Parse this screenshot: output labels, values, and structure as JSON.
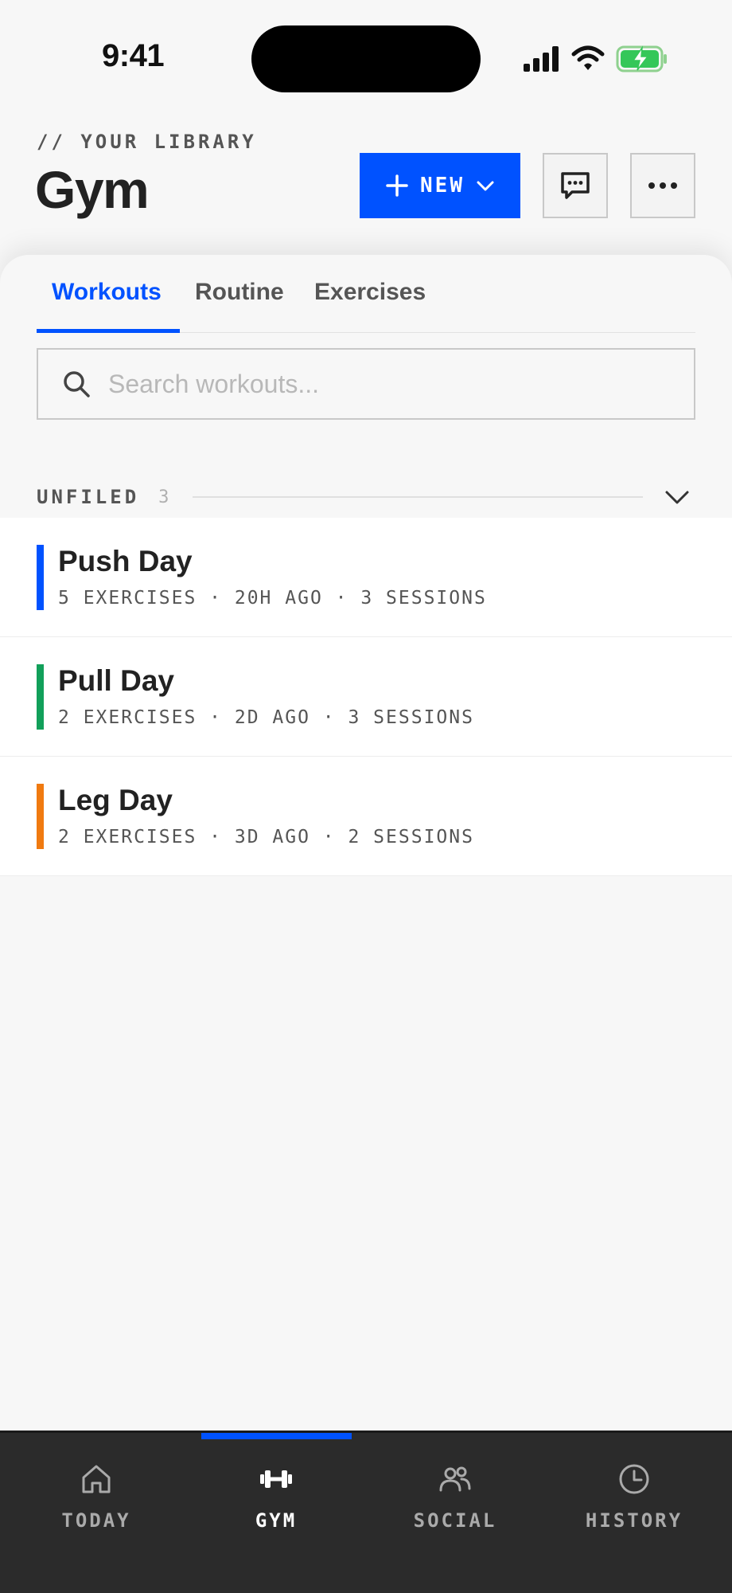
{
  "status_bar": {
    "time": "9:41"
  },
  "header": {
    "eyebrow": "// YOUR LIBRARY",
    "title": "Gym",
    "new_button_label": "NEW"
  },
  "tabs": [
    {
      "label": "Workouts",
      "active": true
    },
    {
      "label": "Routine",
      "active": false
    },
    {
      "label": "Exercises",
      "active": false
    }
  ],
  "search": {
    "placeholder": "Search workouts...",
    "value": ""
  },
  "section": {
    "label": "UNFILED",
    "count": "3"
  },
  "workouts": [
    {
      "name": "Push Day",
      "meta": "5 EXERCISES · 20H AGO · 3 SESSIONS",
      "color": "#0052ff"
    },
    {
      "name": "Pull Day",
      "meta": "2 EXERCISES · 2D AGO · 3 SESSIONS",
      "color": "#12a05a"
    },
    {
      "name": "Leg Day",
      "meta": "2 EXERCISES · 3D AGO · 2 SESSIONS",
      "color": "#f07a10"
    }
  ],
  "nav": [
    {
      "label": "TODAY",
      "icon": "home-icon",
      "active": false
    },
    {
      "label": "GYM",
      "icon": "dumbbell-icon",
      "active": true
    },
    {
      "label": "SOCIAL",
      "icon": "people-icon",
      "active": false
    },
    {
      "label": "HISTORY",
      "icon": "clock-icon",
      "active": false
    }
  ],
  "colors": {
    "accent": "#0052ff",
    "nav_bg": "#2b2b2b",
    "background": "#f7f7f7"
  }
}
